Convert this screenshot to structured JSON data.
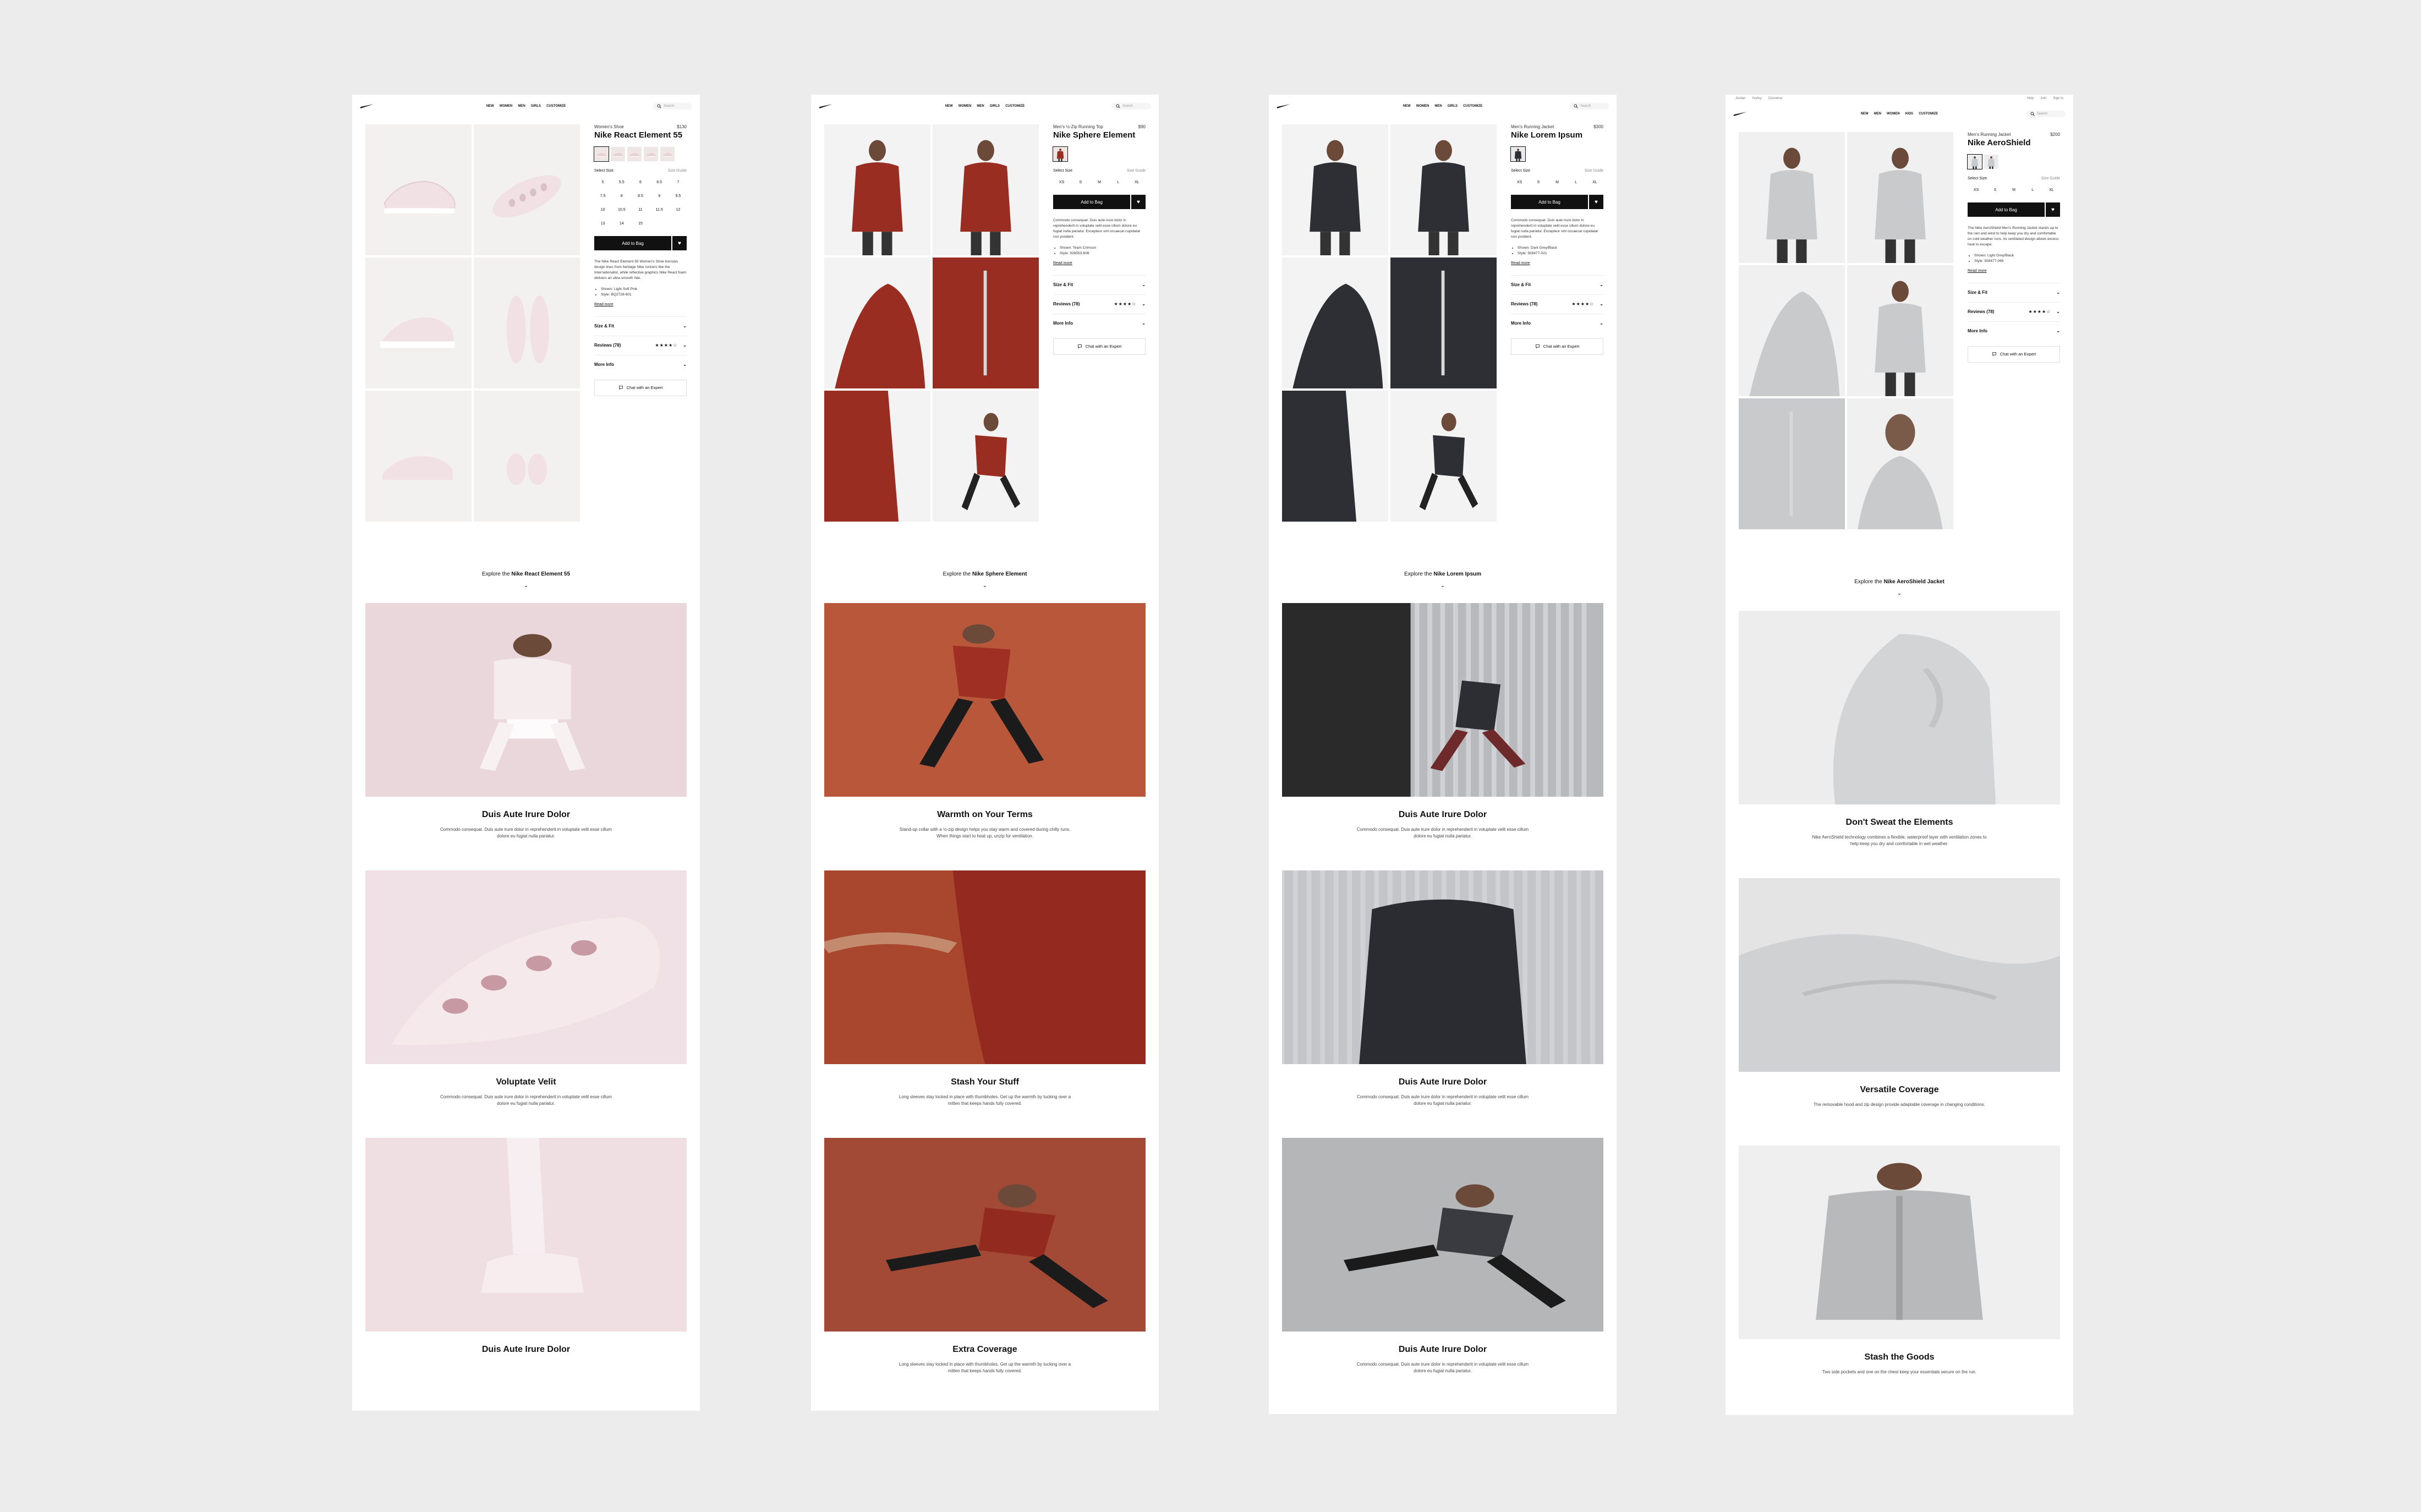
{
  "pages": [
    {
      "id": "p0",
      "util_links": [],
      "util_right": [],
      "nav": [
        "NEW",
        "WOMEN",
        "MEN",
        "GIRLS",
        "CUSTOMIZE"
      ],
      "search_placeholder": "Search",
      "category": "Women's Shoe",
      "price": "$130",
      "title": "Nike React Element 55",
      "size_label": "Select Size",
      "size_guide": "Size Guide",
      "sizes": [
        "5",
        "5.5",
        "6",
        "6.5",
        "7",
        "7.5",
        "8",
        "8.5",
        "9",
        "9.5",
        "10",
        "10.5",
        "11",
        "11.5",
        "12",
        "13",
        "14",
        "15"
      ],
      "add_label": "Add to Bag",
      "description": "The Nike React Element 55 Women's Shoe borrows design lines from heritage Nike runners like the Internationalist, while reflective graphics Nike React foam delivers an ultra-smooth ride.",
      "bullets": [
        "Shown: Light Soft Pink",
        "Style: BQ2728-601"
      ],
      "read_more": "Read more",
      "acc_size": "Size & Fit",
      "acc_reviews": "Reviews (78)",
      "stars": "★★★★☆",
      "acc_more": "More Info",
      "chat": "Chat with an Expert",
      "explore_prefix": "Explore the",
      "explore_name": "Nike React Element 55",
      "features": [
        {
          "title": "Duis Aute Irure Dolor",
          "body": "Commodo consequat. Duis aute irure dolor in reprehenderit in voluptate velit esse cillum dolore eu fugiat nulla pariatur."
        },
        {
          "title": "Voluptate Velit",
          "body": "Commodo consequat. Duis aute irure dolor in reprehenderit in voluptate velit esse cillum dolore eu fugiat nulla pariatur."
        },
        {
          "title": "Duis Aute Irure Dolor",
          "body": ""
        }
      ]
    },
    {
      "id": "p1",
      "util_links": [],
      "util_right": [],
      "nav": [
        "NEW",
        "WOMEN",
        "MEN",
        "GIRLS",
        "CUSTOMIZE"
      ],
      "search_placeholder": "Search",
      "category": "Men's ½-Zip Running Top",
      "price": "$90",
      "title": "Nike Sphere Element",
      "size_label": "Select Size",
      "size_guide": "Size Guide",
      "sizes": [
        "XS",
        "S",
        "M",
        "L",
        "XL"
      ],
      "add_label": "Add to Bag",
      "description": "Commodo consequat. Duis aute irure dolor in reprehenderit in voluptate velit esse cillum dolore eu fugiat nulla pariatur. Excepteur sint occaecat cupidatat non proident.",
      "bullets": [
        "Shown: Team Crimson",
        "Style: 928553-608"
      ],
      "read_more": "Read more",
      "acc_size": "Size & Fit",
      "acc_reviews": "Reviews (78)",
      "stars": "★★★★☆",
      "acc_more": "More Info",
      "chat": "Chat with an Expert",
      "explore_prefix": "Explore the",
      "explore_name": "Nike Sphere Element",
      "features": [
        {
          "title": "Warmth on Your Terms",
          "body": "Stand-up collar with a ½-zip design helps you stay warm and covered during chilly runs. When things start to heat up, unzip for ventilation."
        },
        {
          "title": "Stash Your Stuff",
          "body": "Long sleeves stay locked in place with thumbholes. Get up the warmth by tucking over a mitten that keeps hands fully covered."
        },
        {
          "title": "Extra Coverage",
          "body": "Long sleeves stay locked in place with thumbholes. Get up the warmth by tucking over a mitten that keeps hands fully covered."
        }
      ]
    },
    {
      "id": "p2",
      "util_links": [],
      "util_right": [],
      "nav": [
        "NEW",
        "WOMEN",
        "MEN",
        "GIRLS",
        "CUSTOMIZE"
      ],
      "search_placeholder": "Search",
      "category": "Men's Running Jacket",
      "price": "$300",
      "title": "Nike Lorem Ipsum",
      "size_label": "Select Size",
      "size_guide": "Size Guide",
      "sizes": [
        "XS",
        "S",
        "M",
        "L",
        "XL"
      ],
      "add_label": "Add to Bag",
      "description": "Commodo consequat. Duis aute irure dolor in reprehenderit in voluptate velit esse cillum dolore eu fugiat nulla pariatur. Excepteur sint occaecat cupidatat non proident.",
      "bullets": [
        "Shown: Dark Grey/Black",
        "Style: 928477-021"
      ],
      "read_more": "Read more",
      "acc_size": "Size & Fit",
      "acc_reviews": "Reviews (78)",
      "stars": "★★★★☆",
      "acc_more": "More Info",
      "chat": "Chat with an Expert",
      "explore_prefix": "Explore the",
      "explore_name": "Nike Lorem Ipsum",
      "features": [
        {
          "title": "Duis Aute Irure Dolor",
          "body": "Commodo consequat. Duis aute irure dolor in reprehenderit in voluptate velit esse cillum dolore eu fugiat nulla pariatur."
        },
        {
          "title": "Duis Aute Irure Dolor",
          "body": "Commodo consequat. Duis aute irure dolor in reprehenderit in voluptate velit esse cillum dolore eu fugiat nulla pariatur."
        },
        {
          "title": "Duis Aute Irure Dolor",
          "body": "Commodo consequat. Duis aute irure dolor in reprehenderit in voluptate velit esse cillum dolore eu fugiat nulla pariatur."
        }
      ]
    },
    {
      "id": "p3",
      "util_links": [
        "Jordan",
        "Hurley",
        "Converse"
      ],
      "util_right": [
        "Help",
        "Join",
        "Sign In"
      ],
      "nav": [
        "NEW",
        "MEN",
        "WOMEN",
        "KIDS",
        "CUSTOMIZE"
      ],
      "search_placeholder": "Search",
      "category": "Men's Running Jacket",
      "price": "$200",
      "title": "Nike AeroShield",
      "size_label": "Select Size",
      "size_guide": "Size Guide",
      "sizes": [
        "XS",
        "S",
        "M",
        "L",
        "XL"
      ],
      "add_label": "Add to Bag",
      "description": "The Nike AeroShield Men's Running Jacket stands up to the rain and wind to help keep you dry and comfortable on cold weather runs. Its ventilated design allows excess heat to escape.",
      "bullets": [
        "Shown: Light Grey/Black",
        "Style: 928477-065"
      ],
      "read_more": "Read more",
      "acc_size": "Size & Fit",
      "acc_reviews": "Reviews (78)",
      "stars": "★★★★☆",
      "acc_more": "More Info",
      "chat": "Chat with an Expert",
      "explore_prefix": "Explore the",
      "explore_name": "Nike AeroShield Jacket",
      "features": [
        {
          "title": "Don't Sweat the Elements",
          "body": "Nike AeroShield technology combines a flexible, waterproof layer with ventilation zones to help keep you dry and comfortable in wet weather."
        },
        {
          "title": "Versatile Coverage",
          "body": "The removable hood and zip design provide adaptable coverage in changing conditions."
        },
        {
          "title": "Stash the Goods",
          "body": "Two side pockets and one on the chest keep your essentials secure on the run."
        }
      ]
    }
  ]
}
